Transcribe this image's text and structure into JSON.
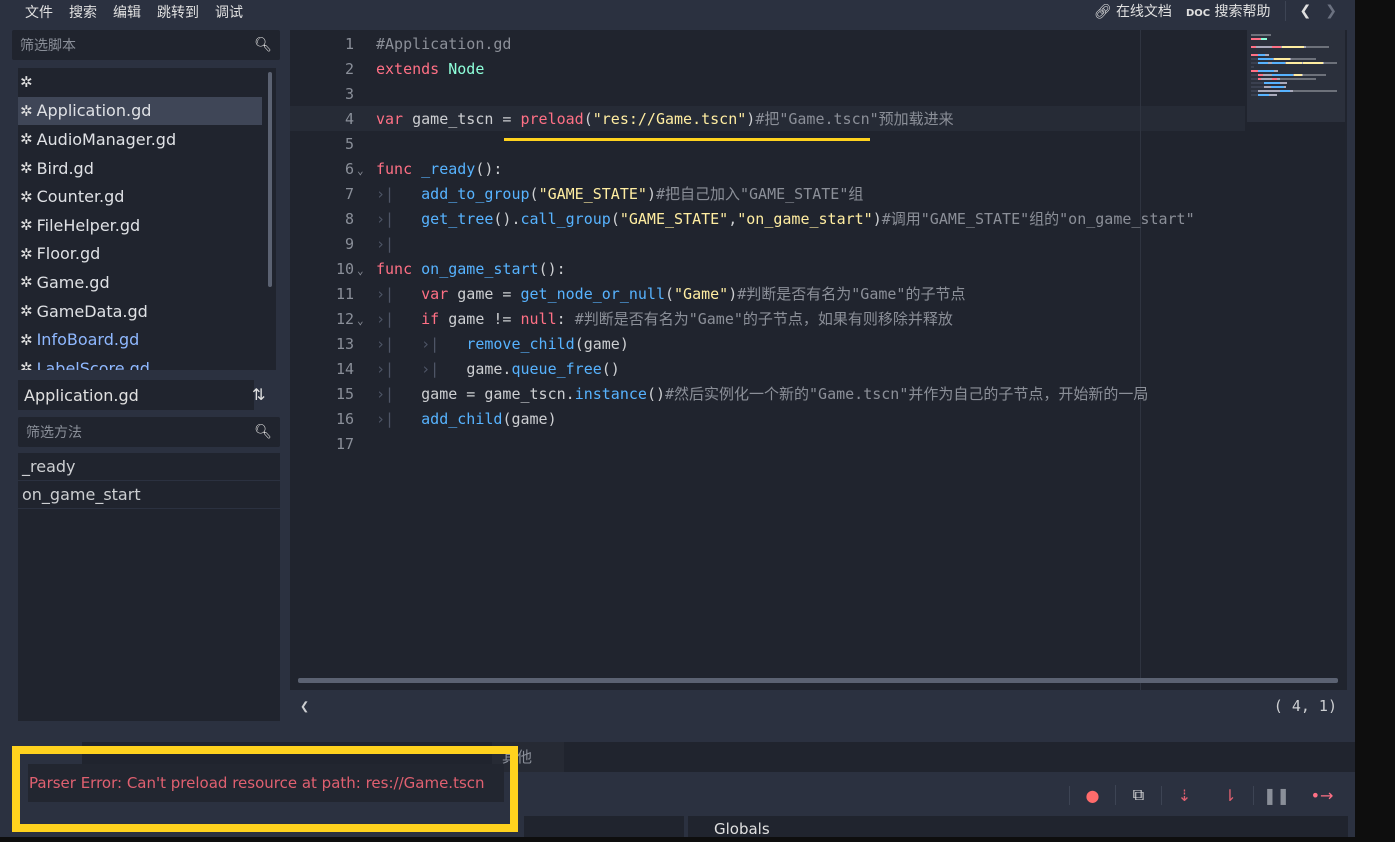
{
  "menu": [
    "文件",
    "搜索",
    "编辑",
    "跳转到",
    "调试"
  ],
  "topright": {
    "online_docs": "在线文档",
    "search_help": "搜索帮助",
    "back": "❮",
    "forward": "❯"
  },
  "scripts": {
    "filter_placeholder": "筛选脚本",
    "items": [
      "",
      "Application.gd",
      "AudioManager.gd",
      "Bird.gd",
      "Counter.gd",
      "FileHelper.gd",
      "Floor.gd",
      "Game.gd",
      "GameData.gd",
      "InfoBoard.gd",
      "LabelScore.gd"
    ],
    "selected": "Application.gd"
  },
  "current_file": "Application.gd",
  "methods": {
    "filter_placeholder": "筛选方法",
    "items": [
      "_ready",
      "on_game_start"
    ]
  },
  "code": {
    "lines": [
      {
        "n": "1",
        "fold": "",
        "tokens": [
          [
            "#Application.gd",
            "c"
          ]
        ]
      },
      {
        "n": "2",
        "fold": "",
        "tokens": [
          [
            "extends ",
            "k"
          ],
          [
            "Node",
            "ty"
          ]
        ]
      },
      {
        "n": "3",
        "fold": "",
        "tokens": []
      },
      {
        "n": "4",
        "fold": "",
        "tokens": [
          [
            "var ",
            "k"
          ],
          [
            "game_tscn = ",
            "t"
          ],
          [
            "preload",
            "k"
          ],
          [
            "(",
            "t"
          ],
          [
            "\"res://Game.tscn\"",
            "s"
          ],
          [
            ")",
            "t"
          ],
          [
            "#把\"Game.tscn\"预加载进来",
            "c"
          ]
        ]
      },
      {
        "n": "5",
        "fold": "",
        "tokens": []
      },
      {
        "n": "6",
        "fold": "⌄",
        "tokens": [
          [
            "func ",
            "k"
          ],
          [
            "_ready",
            "f"
          ],
          [
            "():",
            "t"
          ]
        ]
      },
      {
        "n": "7",
        "fold": "",
        "tokens": [
          [
            "›|   ",
            "tab"
          ],
          [
            "add_to_group",
            "f"
          ],
          [
            "(",
            "t"
          ],
          [
            "\"GAME_STATE\"",
            "s"
          ],
          [
            ")",
            "t"
          ],
          [
            "#把自己加入\"GAME_STATE\"组",
            "c"
          ]
        ]
      },
      {
        "n": "8",
        "fold": "",
        "tokens": [
          [
            "›|   ",
            "tab"
          ],
          [
            "get_tree",
            "f"
          ],
          [
            "().",
            "t"
          ],
          [
            "call_group",
            "f"
          ],
          [
            "(",
            "t"
          ],
          [
            "\"GAME_STATE\"",
            "s"
          ],
          [
            ",",
            "t"
          ],
          [
            "\"on_game_start\"",
            "s"
          ],
          [
            ")",
            "t"
          ],
          [
            "#调用\"GAME_STATE\"组的\"on_game_start\"",
            "c"
          ]
        ]
      },
      {
        "n": "9",
        "fold": "",
        "tokens": [
          [
            "›|",
            "tab"
          ]
        ]
      },
      {
        "n": "10",
        "fold": "⌄",
        "tokens": [
          [
            "func ",
            "k"
          ],
          [
            "on_game_start",
            "f"
          ],
          [
            "():",
            "t"
          ]
        ]
      },
      {
        "n": "11",
        "fold": "",
        "tokens": [
          [
            "›|   ",
            "tab"
          ],
          [
            "var ",
            "k"
          ],
          [
            "game = ",
            "t"
          ],
          [
            "get_node_or_null",
            "f"
          ],
          [
            "(",
            "t"
          ],
          [
            "\"Game\"",
            "s"
          ],
          [
            ")",
            "t"
          ],
          [
            "#判断是否有名为\"Game\"的子节点",
            "c"
          ]
        ]
      },
      {
        "n": "12",
        "fold": "⌄",
        "tokens": [
          [
            "›|   ",
            "tab"
          ],
          [
            "if ",
            "k"
          ],
          [
            "game != ",
            "t"
          ],
          [
            "null",
            "k"
          ],
          [
            ": ",
            "t"
          ],
          [
            "#判断是否有名为\"Game\"的子节点，如果有则移除并释放",
            "c"
          ]
        ]
      },
      {
        "n": "13",
        "fold": "",
        "tokens": [
          [
            "›|   ›|   ",
            "tab"
          ],
          [
            "remove_child",
            "f"
          ],
          [
            "(game)",
            "t"
          ]
        ]
      },
      {
        "n": "14",
        "fold": "",
        "tokens": [
          [
            "›|   ›|   ",
            "tab"
          ],
          [
            "game.",
            "t"
          ],
          [
            "queue_free",
            "f"
          ],
          [
            "()",
            "t"
          ]
        ]
      },
      {
        "n": "15",
        "fold": "",
        "tokens": [
          [
            "›|   ",
            "tab"
          ],
          [
            "game = game_tscn.",
            "t"
          ],
          [
            "instance",
            "f"
          ],
          [
            "()",
            "t"
          ],
          [
            "#然后实例化一个新的\"Game.tscn\"并作为自己的子节点，开始新的一局",
            "c"
          ]
        ]
      },
      {
        "n": "16",
        "fold": "",
        "tokens": [
          [
            "›|   ",
            "tab"
          ],
          [
            "add_child",
            "f"
          ],
          [
            "(game)",
            "t"
          ]
        ]
      },
      {
        "n": "17",
        "fold": "",
        "tokens": []
      }
    ]
  },
  "status": {
    "scroll_left": "❮",
    "position": "(   4,   1)"
  },
  "bottom": {
    "tab_other": "其他",
    "globals": "Globals",
    "error": "Parser Error: Can't preload resource at path: res://Game.tscn"
  },
  "colors": {
    "keyword": "#ff7085",
    "function": "#57b3ff",
    "string": "#ffeda1",
    "highlight": "#ffd21e",
    "error": "#e06070"
  }
}
